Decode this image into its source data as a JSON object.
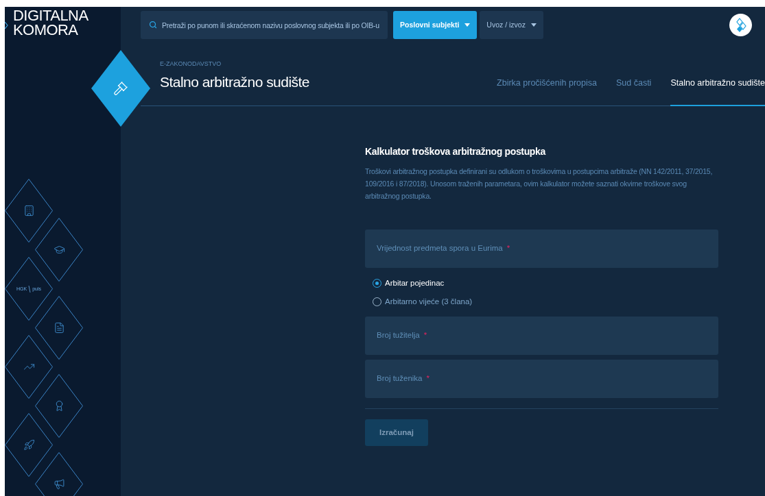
{
  "sidebar": {
    "logo": {
      "line_1": "DIGITALNA",
      "line_2": "KOMORA"
    },
    "items": [
      {
        "kind": "building"
      },
      {
        "kind": "graduation"
      },
      {
        "kind": "brand",
        "text_1": "HGK",
        "text_2": "puls"
      },
      {
        "kind": "document"
      },
      {
        "kind": "chart"
      },
      {
        "kind": "award"
      },
      {
        "kind": "rocket"
      },
      {
        "kind": "megaphone"
      }
    ]
  },
  "header": {
    "search": {
      "placeholder": "Pretraži po punom ili skraćenom nazivu poslovnog subjekta ili po OIB-u"
    },
    "menus": [
      {
        "label": "Poslovni subjekti",
        "selected": true
      },
      {
        "label": "Uvoz / izvoz",
        "selected": false
      }
    ]
  },
  "page": {
    "section": "E-ZAKONODAVSTVO",
    "title": "Stalno arbitražno sudište",
    "tabs": [
      {
        "label": "Zbirka pročišćenih propisa",
        "selected": false
      },
      {
        "label": "Sud časti",
        "selected": false
      },
      {
        "label": "Stalno arbitražno sudište",
        "selected": true
      }
    ]
  },
  "calculator": {
    "title": "Kalkulator troškova arbitražnog postupka",
    "description": "Troškovi arbitražnog postupka definirani su odlukom o troškovima u postupcima arbitraže (NN 142/2011, 37/2015, 109/2016 i 87/2018). Unosom traženih parametara, ovim kalkulator možete saznati okvirne troškove svog arbitražnog postupka.",
    "value_field": {
      "label": "Vrijednost predmeta spora u Eurima",
      "required_mark": "*"
    },
    "arbiters": [
      {
        "label": "Arbitar pojedinac",
        "selected": true
      },
      {
        "label": "Arbitarno vijeće (3 člana)",
        "selected": false
      }
    ],
    "count_fields": [
      {
        "label": "Broj tužitelja",
        "required_mark": "*"
      },
      {
        "label": "Broj tuženika",
        "required_mark": "*"
      }
    ],
    "submit": {
      "label": "Izračunaj",
      "disabled": true
    }
  }
}
